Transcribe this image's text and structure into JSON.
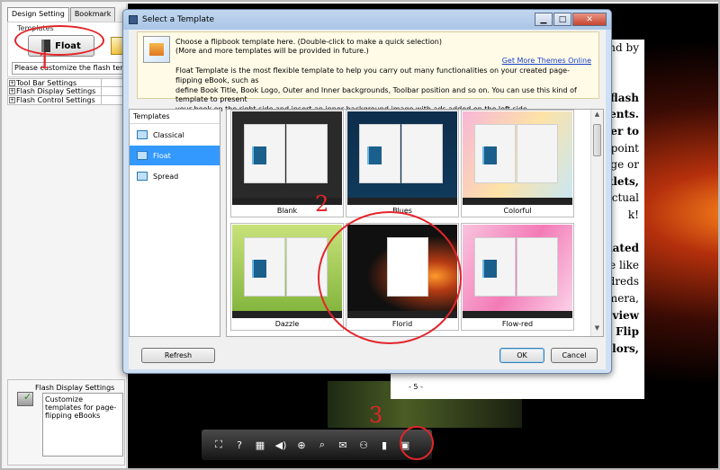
{
  "left_panel": {
    "tabs": [
      "Design Setting",
      "Bookmark"
    ],
    "templates_label": "Templates",
    "float_button": "Float",
    "customize_message": "Please customize the flash template",
    "settings": [
      {
        "label": "Tool Bar Settings",
        "toggle": "+"
      },
      {
        "label": "Flash Display Settings",
        "toggle": "+"
      },
      {
        "label": "Flash Control Settings",
        "toggle": "+"
      }
    ],
    "help_title": "Flash Display Settings",
    "help_text": "Customize templates for page-flipping eBooks"
  },
  "annotations": {
    "one": "1",
    "two": "2",
    "three": "3"
  },
  "dialog": {
    "title": "Select a Template",
    "info_line1": "Choose a flipbook template here. (Double-click to make a quick selection)",
    "info_line2": "(More and more templates will be provided in future.)",
    "get_more_link": "Get More Themes Online",
    "description": "Float Template is the most flexible template to help you carry out many functionalities on your created page-flipping eBook, such as\ndefine Book Title, Book Logo, Outer and Inner backgrounds, Toolbar position and so on. You can use this kind of template to present\nyour book on the right side and insert an inner background image with ads added on the left side.",
    "templates_header": "Templates",
    "categories": [
      {
        "label": "Classical",
        "selected": false
      },
      {
        "label": "Float",
        "selected": true
      },
      {
        "label": "Spread",
        "selected": false
      }
    ],
    "thumbnails": [
      "Blank",
      "Blues",
      "Colorful",
      "Dazzle",
      "Florid",
      "Flow-red"
    ],
    "refresh_button": "Refresh",
    "ok_button": "OK",
    "cancel_button": "Cancel"
  },
  "book_page": {
    "lines": [
      {
        "text": "und by",
        "bold": false
      },
      {
        "text": "",
        "bold": false
      },
      {
        "text": "",
        "bold": false
      },
      {
        "text": "g flash",
        "bold": true
      },
      {
        "text": "ments.",
        "bold": true
      },
      {
        "text": "nter to",
        "bold": true
      },
      {
        "text": "erpoint",
        "bold": false
      },
      {
        "text": "age or",
        "bold": false
      },
      {
        "text": "oklets,",
        "bold": true
      },
      {
        "text": "actual",
        "bold": false
      },
      {
        "text": "k!",
        "bold": false
      },
      {
        "text": "",
        "bold": false
      },
      {
        "text": "mated",
        "bold": true
      },
      {
        "text": "ve like",
        "bold": false
      },
      {
        "text": "ndreds",
        "bold": false
      },
      {
        "text": "amera,",
        "bold": false
      },
      {
        "text": "e view",
        "bold": true
      },
      {
        "text": "D. Flip",
        "bold": true
      },
      {
        "text": "colors,",
        "bold": true
      }
    ],
    "page_number": "- 5 -"
  },
  "colors": {
    "annotation_red": "#e3252a",
    "selection_blue": "#3399ff",
    "link_blue": "#1a40c8"
  },
  "toolbar_icons": [
    "fullscreen-icon",
    "help-icon",
    "thumbnails-icon",
    "sound-icon",
    "zoom-in-icon",
    "search-icon",
    "email-icon",
    "share-icon",
    "print-icon",
    "gift-icon"
  ]
}
